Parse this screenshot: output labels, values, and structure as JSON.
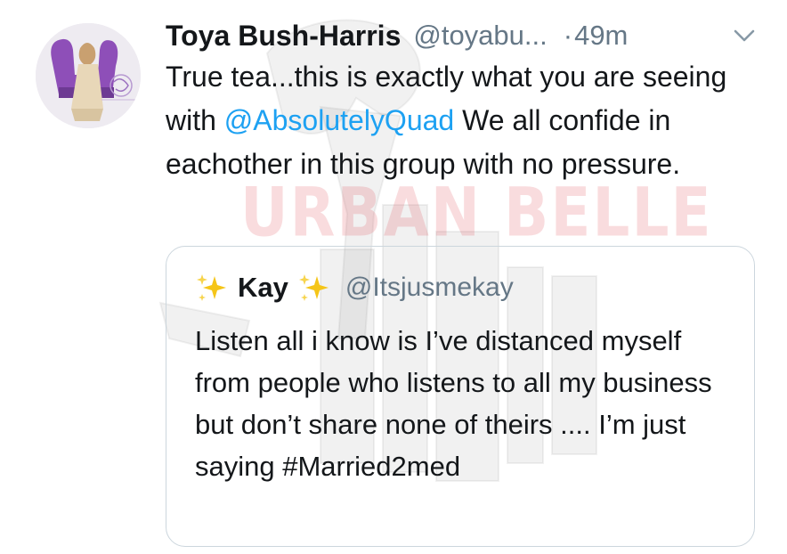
{
  "author": {
    "display_name": "Toya Bush-Harris",
    "handle": "@toyabu...",
    "separator": "·",
    "time": "49m",
    "avatar_icon": "profile-photo-icon"
  },
  "tweet": {
    "text_before": "True tea...this is exactly what you are seeing with ",
    "mention": "@AbsolutelyQuad",
    "text_after": " We all confide in eachother in this group with no pressure."
  },
  "quoted": {
    "display_name": "Kay",
    "handle": "@Itsjusmekay",
    "text": "Listen all i know is I’ve distanced myself from people who listens to all my business but don’t share none of theirs .... I’m just saying #Married2med",
    "name_decoration_icon": "sparkles-icon"
  },
  "watermark": {
    "text": "URBAN BELLE"
  },
  "colors": {
    "link": "#1da1f2",
    "secondary_text": "#657786",
    "border": "#ccd6dd",
    "sparkle": "#f5c518"
  }
}
